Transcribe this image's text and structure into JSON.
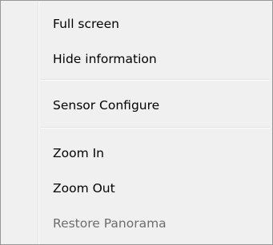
{
  "context_menu": {
    "items": [
      {
        "label": "Full screen",
        "enabled": true
      },
      {
        "label": "Hide information",
        "enabled": true
      },
      {
        "label": "Sensor Configure",
        "enabled": true
      },
      {
        "label": "Zoom In",
        "enabled": true
      },
      {
        "label": "Zoom Out",
        "enabled": true
      },
      {
        "label": "Restore Panorama",
        "enabled": false
      }
    ]
  }
}
